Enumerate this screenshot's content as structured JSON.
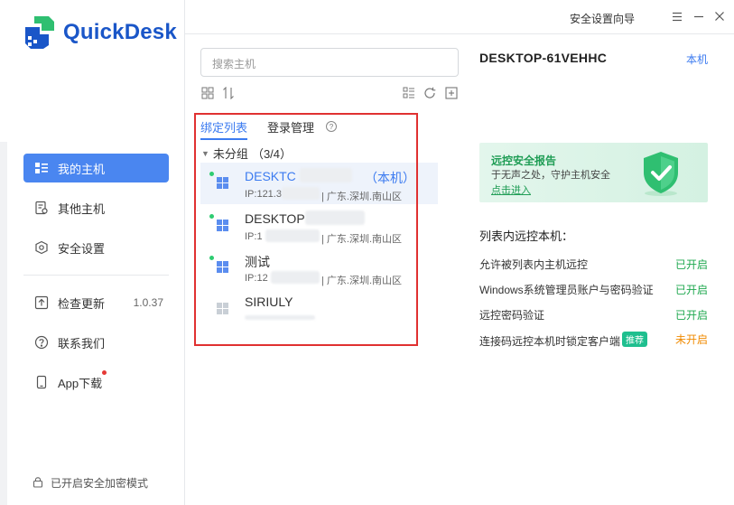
{
  "app": {
    "name": "QuickDesk"
  },
  "titlebar": {
    "guide_label": "安全设置向导",
    "menu_icon": "menu-icon",
    "minimize_icon": "minimize-icon",
    "close_icon": "close-icon"
  },
  "sidebar": {
    "items": [
      {
        "label": "我的主机",
        "icon": "host-list-icon",
        "active": true
      },
      {
        "label": "其他主机",
        "icon": "other-host-icon",
        "active": false
      },
      {
        "label": "安全设置",
        "icon": "shield-settings-icon",
        "active": false
      }
    ],
    "bottom_items": [
      {
        "label": "检查更新",
        "icon": "upload-icon",
        "version": "1.0.37"
      },
      {
        "label": "联系我们",
        "icon": "help-icon"
      },
      {
        "label": "App下载",
        "icon": "phone-icon"
      }
    ],
    "footer": "已开启安全加密模式"
  },
  "search": {
    "placeholder": "搜索主机"
  },
  "tabs": [
    {
      "label": "绑定列表",
      "active": true
    },
    {
      "label": "登录管理",
      "active": false
    }
  ],
  "group": {
    "name": "未分组",
    "count": "（3/4）"
  },
  "hosts": [
    {
      "name": "DESKTC",
      "tag": "（本机）",
      "ip": "IP:121.3",
      "location": "| 广东.深圳.南山区",
      "online": true
    },
    {
      "name": "DESKTOP",
      "tag": "",
      "ip": "IP:1",
      "location": "| 广东.深圳.南山区",
      "online": true
    },
    {
      "name": "测试",
      "tag": "",
      "ip": "IP:12",
      "location": "| 广东.深圳.南山区",
      "online": true
    },
    {
      "name": "SIRIULY",
      "tag": "",
      "ip": "",
      "location": "",
      "online": false
    }
  ],
  "detail": {
    "machine_name": "DESKTOP-61VEHHC",
    "this_machine_label": "本机",
    "banner": {
      "title": "远控安全报告",
      "subtitle": "于无声之处，守护主机安全",
      "link": "点击进入"
    },
    "section_title": "列表内远控本机：",
    "settings": [
      {
        "label": "允许被列表内主机远控",
        "status": "已开启",
        "on": true
      },
      {
        "label": "Windows系统管理员账户与密码验证",
        "status": "已开启",
        "on": true
      },
      {
        "label": "远控密码验证",
        "status": "已开启",
        "on": true
      },
      {
        "label": "连接码远控本机时锁定客户端",
        "badge": "推荐",
        "status": "未开启",
        "on": false
      }
    ]
  }
}
